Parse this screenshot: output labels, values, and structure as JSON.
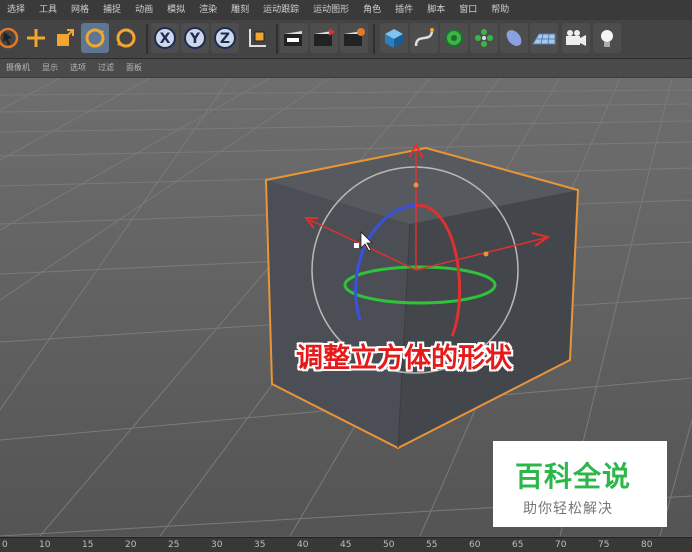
{
  "menu": [
    "选择",
    "工具",
    "网格",
    "捕捉",
    "动画",
    "模拟",
    "渲染",
    "雕刻",
    "运动跟踪",
    "运动图形",
    "角色",
    "插件",
    "脚本",
    "窗口",
    "帮助"
  ],
  "view_menu": [
    "摄像机",
    "显示",
    "选项",
    "过滤",
    "面板"
  ],
  "toolbar": {
    "icons": [
      "move-tool-icon",
      "add-tool-icon",
      "scale-tool-icon",
      "rotate-tool-icon",
      "rotate-alt-icon",
      "x-axis-icon",
      "y-axis-icon",
      "z-axis-icon",
      "coordinate-system-icon",
      "render-view-icon",
      "render-picture-viewer-icon",
      "edit-render-settings-icon",
      "cube-icon",
      "spline-pen-icon",
      "nurbs-icon",
      "array-icon",
      "deformer-icon",
      "floor-icon",
      "camera-icon",
      "light-icon"
    ],
    "axis_labels": [
      "X",
      "Y",
      "Z"
    ]
  },
  "caption": "调整立方体的形状",
  "watermark": {
    "title": "百科全说",
    "subtitle": "助你轻松解决"
  },
  "timeline": {
    "ticks": [
      "0",
      "10",
      "15",
      "20",
      "25",
      "30",
      "35",
      "40",
      "45",
      "50",
      "55",
      "60",
      "65",
      "70",
      "75",
      "80"
    ]
  },
  "colors": {
    "caption": "#e51b1b",
    "watermark_green": "#2db64a",
    "x_axis": "#e03030",
    "y_axis": "#2fc23a",
    "z_axis": "#3a50e0",
    "selection_outline": "#e8953a"
  }
}
